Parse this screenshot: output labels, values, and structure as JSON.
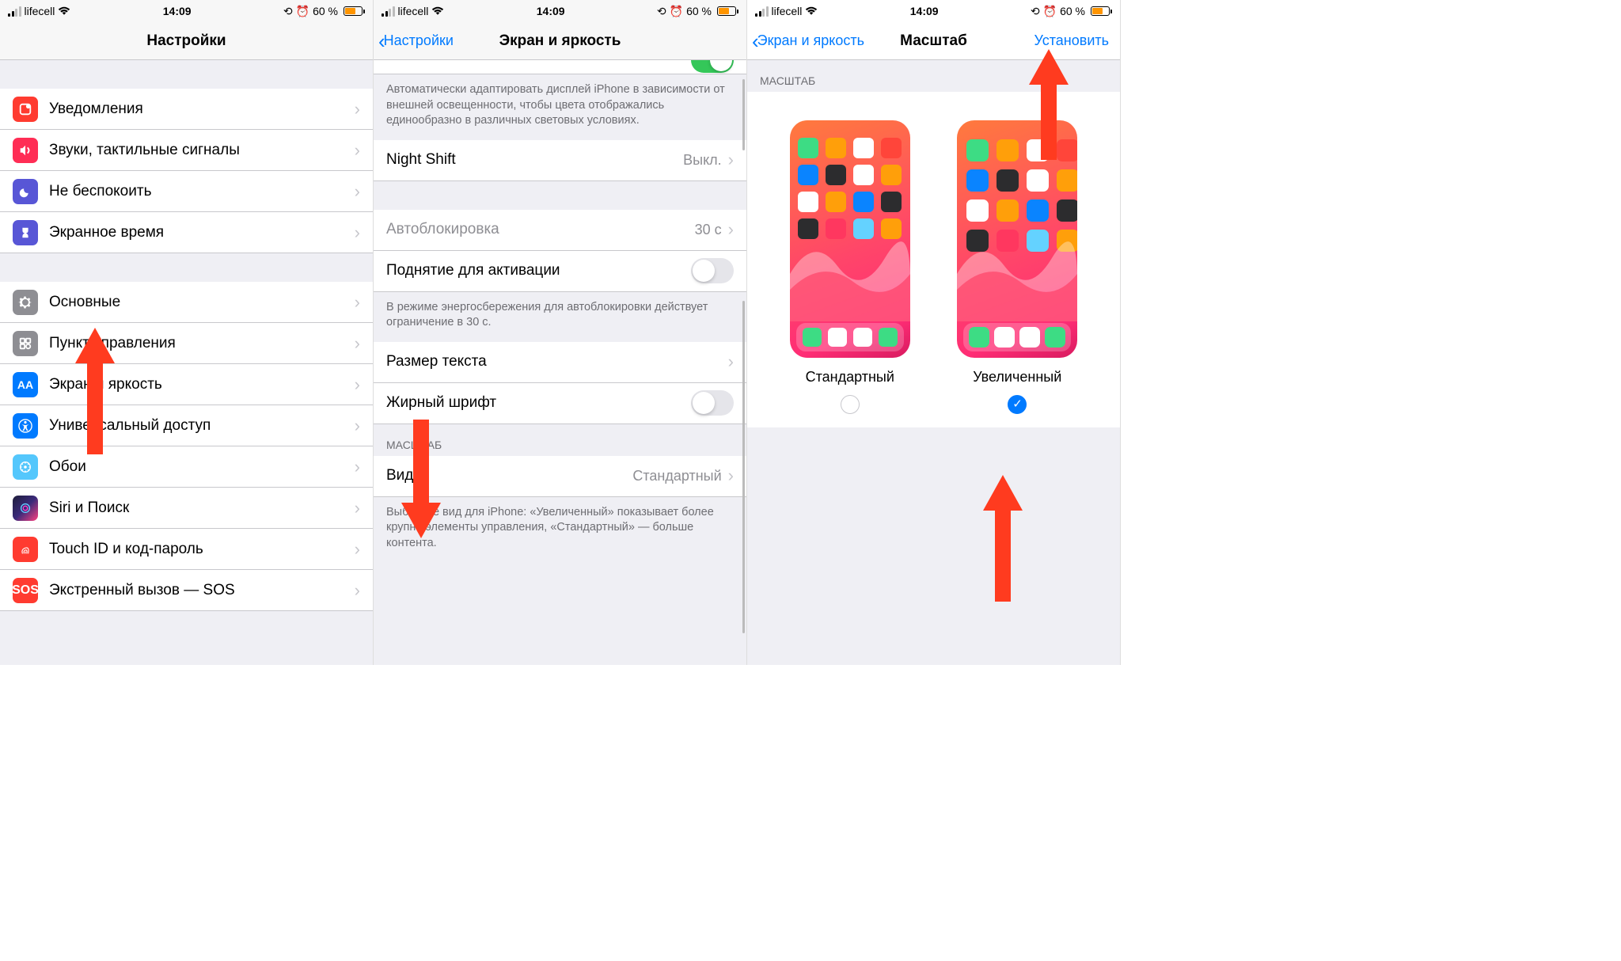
{
  "status": {
    "carrier": "lifecell",
    "time": "14:09",
    "battery_pct": "60 %"
  },
  "p1": {
    "title": "Настройки",
    "items": {
      "notif": "Уведомления",
      "sounds": "Звуки, тактильные сигналы",
      "dnd": "Не беспокоить",
      "screentime": "Экранное время",
      "general": "Основные",
      "control": "Пункт управления",
      "display": "Экран и яркость",
      "access": "Универсальный доступ",
      "wall": "Обои",
      "siri": "Siri и Поиск",
      "touchid": "Touch ID и код-пароль",
      "sos": "Экстренный вызов — SOS"
    }
  },
  "p2": {
    "back": "Настройки",
    "title": "Экран и яркость",
    "auto_bright_footer": "Автоматически адаптировать дисплей iPhone в зависимости от внешней освещенности, чтобы цвета отображались единообразно в различных световых условиях.",
    "nightshift": "Night Shift",
    "nightshift_val": "Выкл.",
    "autolock": "Автоблокировка",
    "autolock_val": "30 с",
    "raise": "Поднятие для активации",
    "power_save_footer": "В режиме энергосбережения для автоблокировки действует ограничение в 30 с.",
    "textsize": "Размер текста",
    "bold": "Жирный шрифт",
    "zoom_header": "МАСШТАБ",
    "view": "Вид",
    "view_val": "Стандартный",
    "view_footer": "Выберите вид для iPhone: «Увеличенный» показывает более крупно элементы управления, «Стандартный» — больше контента."
  },
  "p3": {
    "back": "Экран и яркость",
    "title": "Масштаб",
    "action": "Установить",
    "header": "МАСШТАБ",
    "standard": "Стандартный",
    "zoomed": "Увеличенный"
  },
  "app_colors": {
    "row1": [
      "#3ddc84",
      "#ff9f0a",
      "#ffffff",
      "#ff453a"
    ],
    "row2": [
      "#0a84ff",
      "#2c2c2e",
      "#ffffff",
      "#ff9f0a"
    ],
    "row3": [
      "#ffffff",
      "#ff9f0a",
      "#0a84ff",
      "#2c2c2e"
    ],
    "row4": [
      "#2c2c2e",
      "#ff375f",
      "#64d2ff",
      "#ff9f0a"
    ],
    "dock": [
      "#3ddc84",
      "#ffffff",
      "#ffffff",
      "#3ddc84"
    ]
  }
}
